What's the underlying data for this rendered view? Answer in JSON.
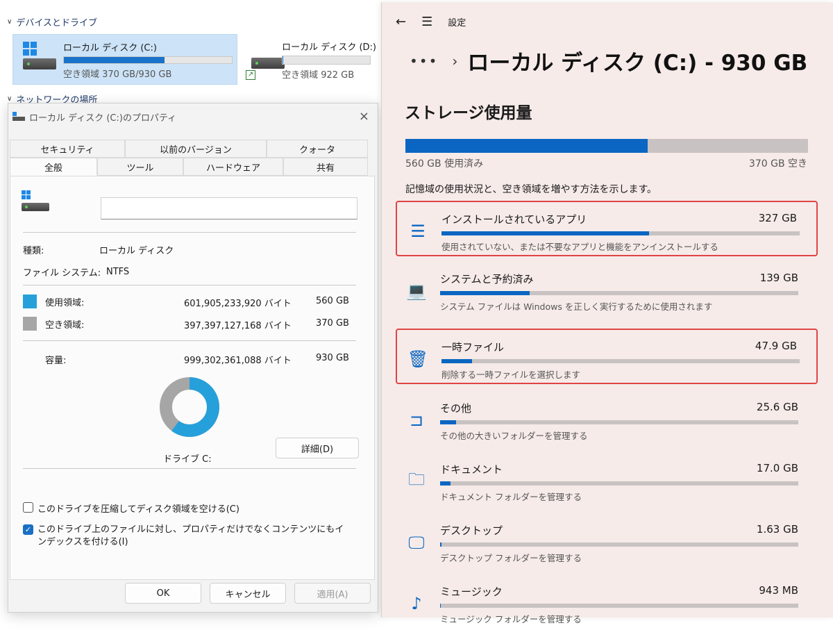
{
  "explorer": {
    "section_devices": "デバイスとドライブ",
    "section_network": "ネットワークの場所",
    "drives": [
      {
        "name": "ローカル ディスク (C:)",
        "free": "空き領域 370 GB/930 GB",
        "used_fraction": 0.6
      },
      {
        "name": "ローカル ディスク (D:)",
        "free": "空き領域 922 GB",
        "used_fraction": 0.01
      }
    ]
  },
  "dialog": {
    "title": "ローカル ディスク (C:)のプロパティ",
    "close": "×",
    "tabs_top": [
      "セキュリティ",
      "以前のバージョン",
      "クォータ"
    ],
    "tabs_bottom": [
      "全般",
      "ツール",
      "ハードウェア",
      "共有"
    ],
    "label_value": "",
    "type_label": "種類:",
    "type_value": "ローカル ディスク",
    "fs_label": "ファイル システム:",
    "fs_value": "NTFS",
    "used_label": "使用領域:",
    "used_bytes": "601,905,233,920 バイト",
    "used_gb": "560 GB",
    "free_label": "空き領域:",
    "free_bytes": "397,397,127,168 バイト",
    "free_gb": "370 GB",
    "cap_label": "容量:",
    "cap_bytes": "999,302,361,088 バイト",
    "cap_gb": "930 GB",
    "drive_label": "ドライブ C:",
    "details_button": "詳細(D)",
    "compress_label": "このドライブを圧縮してディスク領域を空ける(C)",
    "index_label": "このドライブ上のファイルに対し、プロパティだけでなくコンテンツにもインデックスを付ける(I)",
    "ok": "OK",
    "cancel": "キャンセル",
    "apply": "適用(A)",
    "used_color": "#26a0da",
    "free_color": "#a6a6a6"
  },
  "settings": {
    "app_title": "設定",
    "breadcrumb_dots": "•••",
    "page_title": "ローカル ディスク (C:) - 930 GB",
    "section_title": "ストレージ使用量",
    "used_text": "560 GB 使用済み",
    "free_text": "370 GB 空き",
    "used_fraction": 0.602,
    "description": "記憶域の使用状況と、空き領域を増やす方法を示します。",
    "categories": [
      {
        "name": "インストールされているアプリ",
        "size": "327 GB",
        "sub": "使用されていない、または不要なアプリと機能をアンインストールする",
        "fraction": 0.58,
        "icon": "list-icon",
        "highlighted": true
      },
      {
        "name": "システムと予約済み",
        "size": "139 GB",
        "sub": "システム ファイルは Windows を正しく実行するために使用されます",
        "fraction": 0.25,
        "icon": "laptop-icon",
        "highlighted": false
      },
      {
        "name": "一時ファイル",
        "size": "47.9 GB",
        "sub": "削除する一時ファイルを選択します",
        "fraction": 0.085,
        "icon": "trash-icon",
        "highlighted": true
      },
      {
        "name": "その他",
        "size": "25.6 GB",
        "sub": "その他の大きいフォルダーを管理する",
        "fraction": 0.045,
        "icon": "door-icon",
        "highlighted": false
      },
      {
        "name": "ドキュメント",
        "size": "17.0 GB",
        "sub": "ドキュメント フォルダーを管理する",
        "fraction": 0.03,
        "icon": "folder-icon",
        "highlighted": false
      },
      {
        "name": "デスクトップ",
        "size": "1.63 GB",
        "sub": "デスクトップ フォルダーを管理する",
        "fraction": 0.003,
        "icon": "monitor-icon",
        "highlighted": false
      },
      {
        "name": "ミュージック",
        "size": "943 MB",
        "sub": "ミュージック フォルダーを管理する",
        "fraction": 0.002,
        "icon": "music-icon",
        "highlighted": false
      }
    ]
  }
}
